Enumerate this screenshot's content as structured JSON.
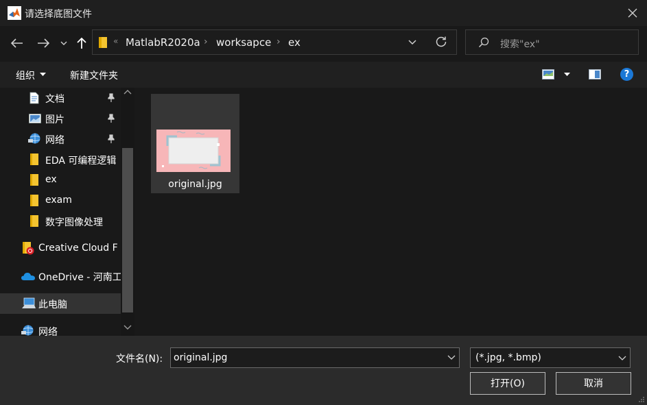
{
  "window": {
    "title": "请选择底图文件"
  },
  "address": {
    "crumbs": [
      "MatlabR2020a",
      "worksapce",
      "ex"
    ],
    "overflow": "«"
  },
  "search": {
    "placeholder": "搜索\"ex\""
  },
  "toolbar": {
    "organize_label": "组织",
    "new_folder_label": "新建文件夹",
    "help_label": "?"
  },
  "nav": {
    "items": [
      {
        "label": "文档",
        "icon": "document-icon",
        "pinned": true
      },
      {
        "label": "图片",
        "icon": "picture-icon",
        "pinned": true
      },
      {
        "label": "网络",
        "icon": "network-icon",
        "pinned": true
      },
      {
        "label": "EDA 可编程逻辑",
        "icon": "folder-icon"
      },
      {
        "label": "ex",
        "icon": "folder-icon"
      },
      {
        "label": "exam",
        "icon": "folder-icon"
      },
      {
        "label": "数字图像处理",
        "icon": "folder-icon"
      },
      {
        "label": "Creative Cloud F",
        "icon": "creative-cloud-folder-icon"
      },
      {
        "label": "OneDrive - 河南工",
        "icon": "onedrive-icon"
      },
      {
        "label": "此电脑",
        "icon": "computer-icon",
        "selected": true
      },
      {
        "label": "网络",
        "icon": "network-icon"
      }
    ]
  },
  "files": [
    {
      "name": "original.jpg"
    }
  ],
  "bottom": {
    "filename_label": "文件名(N):",
    "filename_value": "original.jpg",
    "filter_value": "(*.jpg, *.bmp)",
    "open_label": "打开(O)",
    "cancel_label": "取消"
  },
  "colors": {
    "accent": "#1b78d6",
    "folder": "#f4c430",
    "background": "#191919"
  }
}
